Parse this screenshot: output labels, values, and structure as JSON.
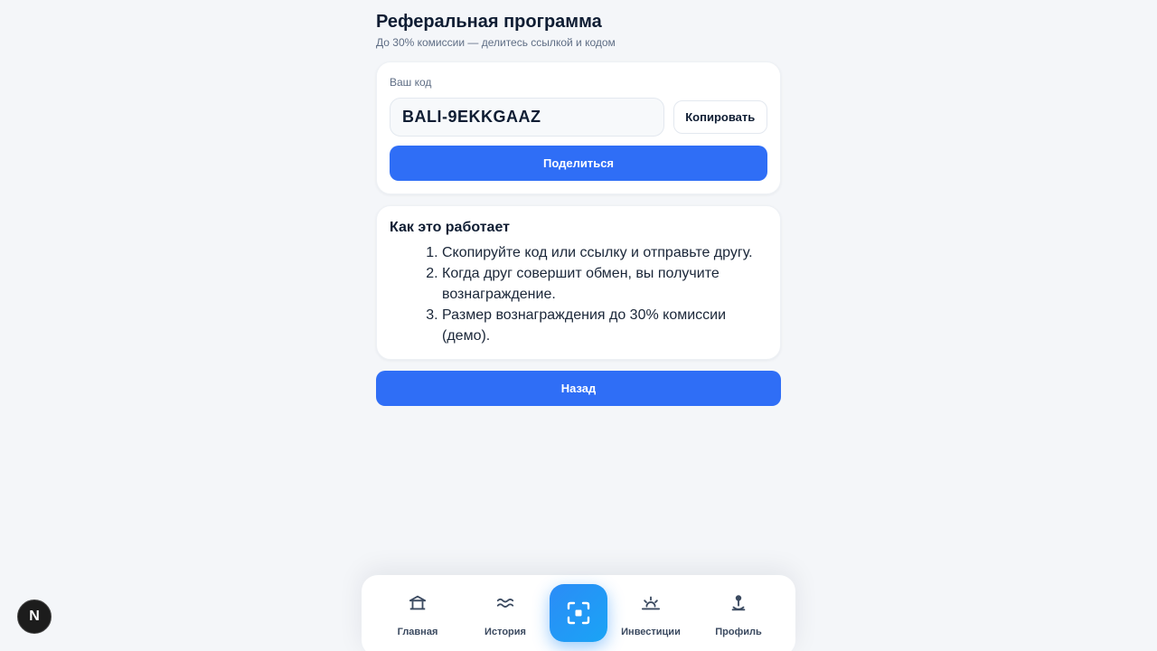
{
  "header": {
    "title": "Реферальная программа",
    "subtitle": "До 30% комиссии — делитесь ссылкой и кодом"
  },
  "referral": {
    "code_label": "Ваш код",
    "code": "BALI-9EKKGAAZ",
    "copy_label": "Копировать",
    "share_label": "Поделиться"
  },
  "how_it_works": {
    "title": "Как это работает",
    "steps": [
      "Скопируйте код или ссылку и отправьте другу.",
      "Когда друг совершит обмен, вы получите вознаграждение.",
      "Размер вознаграждения до 30% комиссии (демо)."
    ]
  },
  "back_label": "Назад",
  "bottom_nav": {
    "items": [
      {
        "label": "Главная",
        "icon": "bank-icon"
      },
      {
        "label": "История",
        "icon": "waves-icon"
      },
      {
        "label": "",
        "icon": "scan-icon"
      },
      {
        "label": "Инвестиции",
        "icon": "sunrise-icon"
      },
      {
        "label": "Профиль",
        "icon": "user-pin-icon"
      }
    ]
  },
  "dev_badge": {
    "text": "N",
    "icon": "nextjs-icon"
  },
  "colors": {
    "accent": "#2f6ef6",
    "background": "#f4f6f9",
    "card": "#ffffff",
    "text": "#0f1d33",
    "muted": "#5f6e85"
  }
}
